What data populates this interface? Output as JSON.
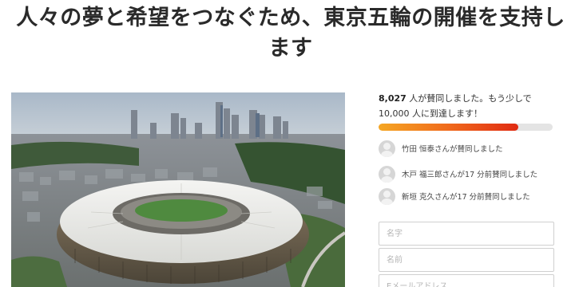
{
  "page": {
    "title": "人々の夢と希望をつなぐため、東京五輪の開催を支持します"
  },
  "petition": {
    "signature_count": "8,027",
    "count_suffix": " 人が賛同しました。もう少しで",
    "goal_text": "10,000 人に到達します！",
    "progress_fraction": 0.8027
  },
  "recent_signers": [
    {
      "name": "竹田 恒泰",
      "suffix": "さんが賛同しました"
    },
    {
      "name": "木戸 福三郎",
      "suffix": "さんが17 分前賛同しました"
    },
    {
      "name": "新垣 克久",
      "suffix": "さんが17 分前賛同しました"
    }
  ],
  "form": {
    "last_name_placeholder": "名字",
    "first_name_placeholder": "名前",
    "email_placeholder": "Eメールアドレス"
  },
  "colors": {
    "progress_start": "#f5a623",
    "progress_end": "#e02a12",
    "progress_track": "#e4e4e4"
  },
  "icons": {
    "signer_avatar": "default-user-avatar-icon"
  }
}
